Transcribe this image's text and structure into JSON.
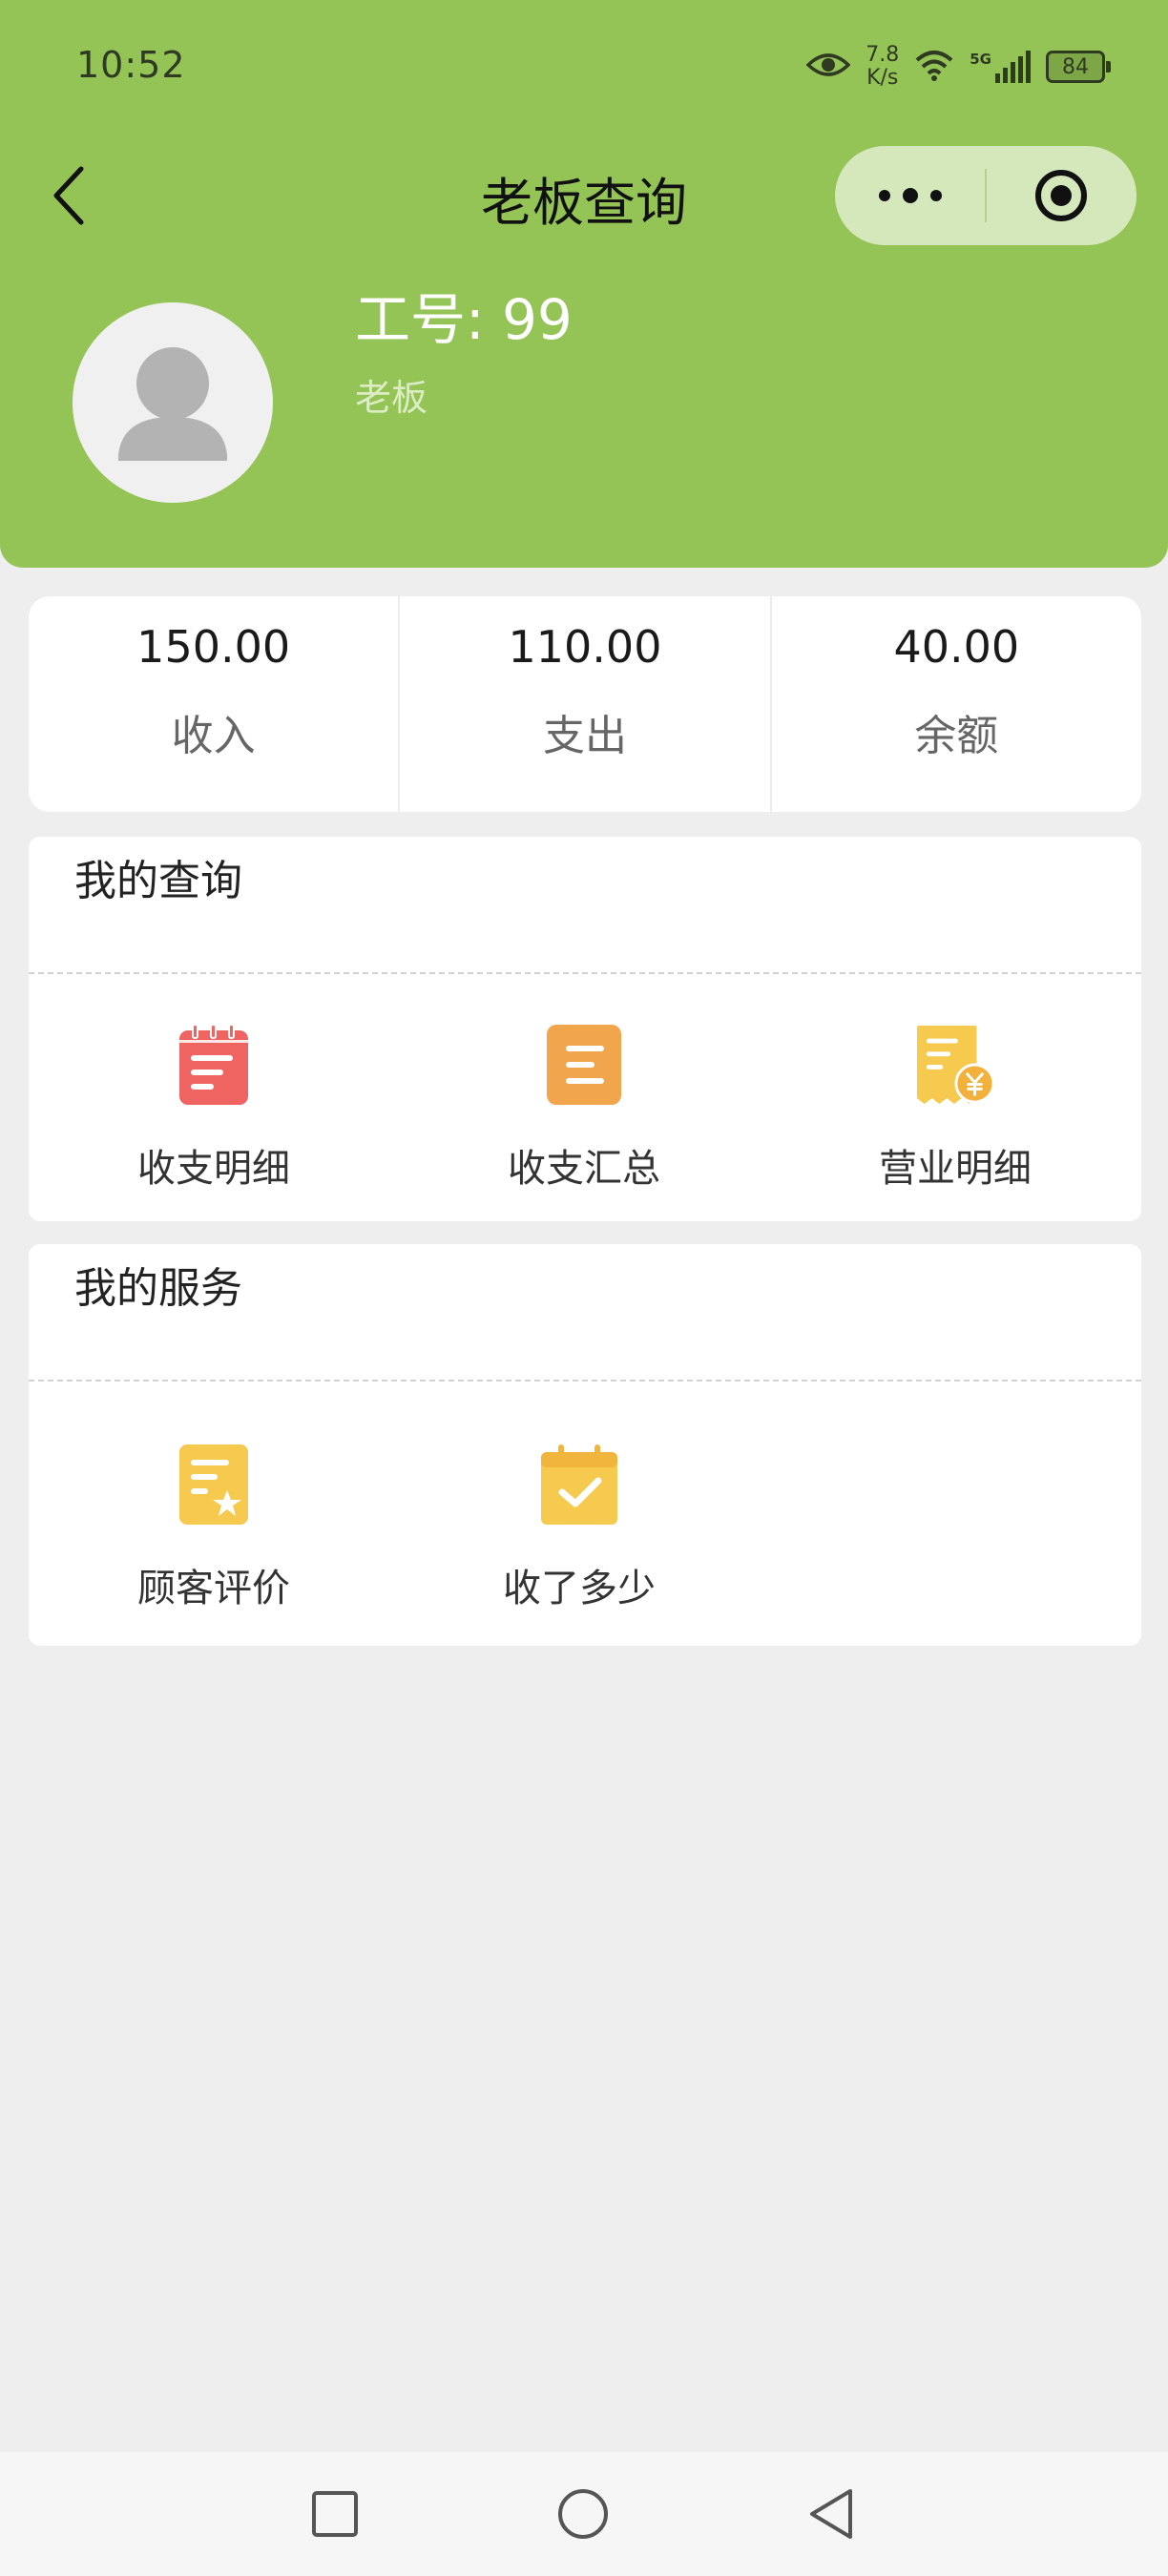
{
  "status_bar": {
    "time": "10:52",
    "net_speed_value": "7.8",
    "net_speed_unit": "K/s",
    "signal_label": "5G",
    "battery_level": "84",
    "icons": [
      "eye-icon",
      "wifi-icon",
      "signal-icon",
      "battery-icon"
    ]
  },
  "nav": {
    "title": "老板查询",
    "back_icon": "chevron-left-icon",
    "more_icon": "more-dots-icon",
    "close_icon": "target-circle-icon"
  },
  "profile": {
    "employee_no": "工号: 99",
    "role": "老板",
    "avatar_icon": "user-silhouette-icon"
  },
  "stats": [
    {
      "value": "150.00",
      "label": "收入"
    },
    {
      "value": "110.00",
      "label": "支出"
    },
    {
      "value": "40.00",
      "label": "余额"
    }
  ],
  "queries": {
    "title": "我的查询",
    "items": [
      {
        "label": "收支明细",
        "icon": "red-notepad-icon",
        "color": "#ef6461"
      },
      {
        "label": "收支汇总",
        "icon": "orange-list-icon",
        "color": "#f1a54c"
      },
      {
        "label": "营业明细",
        "icon": "yellow-receipt-yen-icon",
        "color": "#f6c94f"
      }
    ]
  },
  "services": {
    "title": "我的服务",
    "items": [
      {
        "label": "顾客评价",
        "icon": "yellow-star-document-icon",
        "color": "#f6c94f"
      },
      {
        "label": "收了多少",
        "icon": "yellow-calendar-check-icon",
        "color": "#f6c94f"
      }
    ]
  },
  "system_nav": {
    "icons": [
      "recent-apps-square-icon",
      "home-circle-icon",
      "back-triangle-icon"
    ]
  }
}
